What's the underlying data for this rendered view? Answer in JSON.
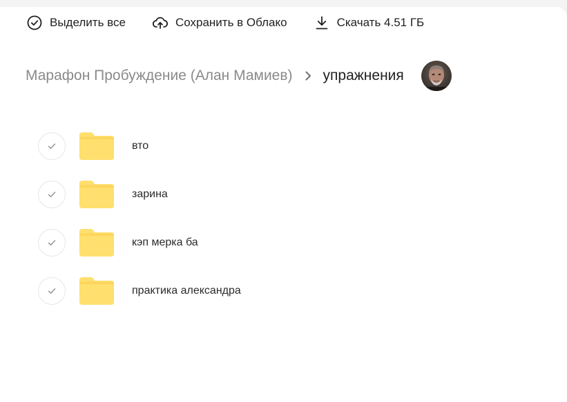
{
  "toolbar": {
    "select_all": {
      "label": "Выделить все",
      "icon": "check-circle-icon"
    },
    "save_cloud": {
      "label": "Сохранить в Облако",
      "icon": "cloud-upload-icon"
    },
    "download": {
      "label": "Скачать 4.51 ГБ",
      "icon": "download-icon"
    }
  },
  "breadcrumb": {
    "parent": "Марафон Пробуждение (Алан Мамиев)",
    "separator_icon": "chevron-right-icon",
    "current": "упражнения",
    "avatar_icon": "user-avatar"
  },
  "folders": [
    {
      "name": "вто",
      "icon": "folder-icon"
    },
    {
      "name": "зарина",
      "icon": "folder-icon"
    },
    {
      "name": "кэп мерка ба",
      "icon": "folder-icon"
    },
    {
      "name": "практика александра",
      "icon": "folder-icon"
    }
  ],
  "colors": {
    "folder": "#ffdf6e",
    "folder_tab": "#fdd55c",
    "text_primary": "#1f1f1f",
    "text_muted": "#8a8a8a",
    "checkbox_border": "#e6e6e6"
  }
}
